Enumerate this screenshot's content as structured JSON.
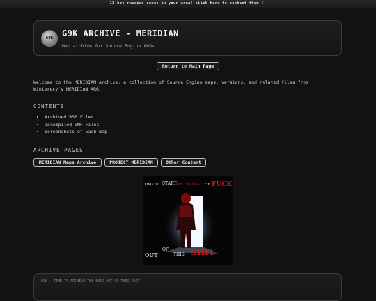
{
  "ad_banner": "12 hot russian cones in your area! click here to contect them!!!",
  "header": {
    "logo_text": "G9K",
    "title": "G9K ARCHIVE - MERIDIAN",
    "subtitle": "Map archive for Source Engine ARGs"
  },
  "nav": {
    "return_label": "Return to Main Page"
  },
  "intro_text": "Welcome to the MERIDIAN archive, a collection of Source Engine maps, versions, and related files from Winterecy's MERIDIAN ARG.",
  "contents": {
    "heading": "CONTENTS",
    "items": [
      "Archived BSP Files",
      "Decompiled VMF Files",
      "Screenshots of Each map"
    ]
  },
  "archive_pages": {
    "heading": "ARCHIVE PAGES",
    "buttons": [
      "MERIDIAN Maps Archive",
      "PROJECT MERIDIAN",
      "Other Content"
    ]
  },
  "poster": {
    "top_words": [
      "TIME",
      "TO",
      "START",
      "ARCHIVING",
      "THE",
      "FUCK"
    ],
    "bottom_words": [
      "OUT",
      "OF",
      "THIS",
      "SHIT"
    ],
    "colors": {
      "red": "#d01818",
      "white": "#f0f0f0",
      "glow": "#cfe3ff"
    }
  },
  "footer": {
    "text": "G9K - TIME TO ARCHIVE THE FUCK OUT OF THIS SHIT"
  }
}
